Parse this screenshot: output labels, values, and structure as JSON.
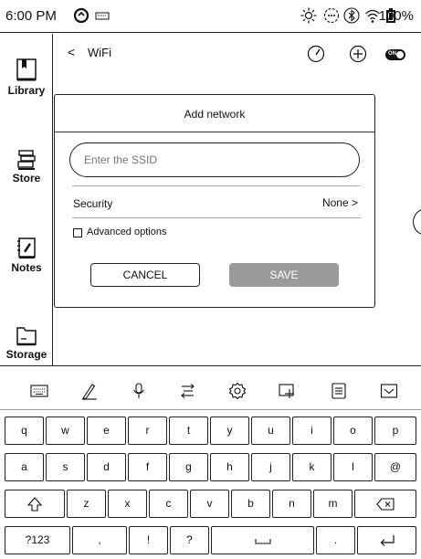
{
  "status_bar": {
    "time": "6:00 PM",
    "battery": "100%"
  },
  "sidebar": {
    "items": [
      {
        "label": "Library",
        "icon": "library-icon"
      },
      {
        "label": "Store",
        "icon": "store-icon"
      },
      {
        "label": "Notes",
        "icon": "notes-icon"
      },
      {
        "label": "Storage",
        "icon": "storage-icon"
      }
    ]
  },
  "header": {
    "back": "<",
    "title": "WiFi",
    "toggle_label": "ON"
  },
  "dialog": {
    "title": "Add network",
    "ssid_placeholder": "Enter the SSID",
    "ssid_value": "",
    "security_label": "Security",
    "security_value": "None >",
    "advanced_label": "Advanced options",
    "cancel_label": "CANCEL",
    "save_label": "SAVE"
  },
  "keyboard": {
    "row1": [
      "q",
      "w",
      "e",
      "r",
      "t",
      "y",
      "u",
      "i",
      "o",
      "p"
    ],
    "row2": [
      "a",
      "s",
      "d",
      "f",
      "g",
      "h",
      "j",
      "k",
      "l",
      "@"
    ],
    "row3": [
      "z",
      "x",
      "c",
      "v",
      "b",
      "n",
      "m"
    ],
    "row4": {
      "sym": "?123",
      "comma": ",",
      "excl": "!",
      "question": "?",
      "period": "."
    }
  }
}
